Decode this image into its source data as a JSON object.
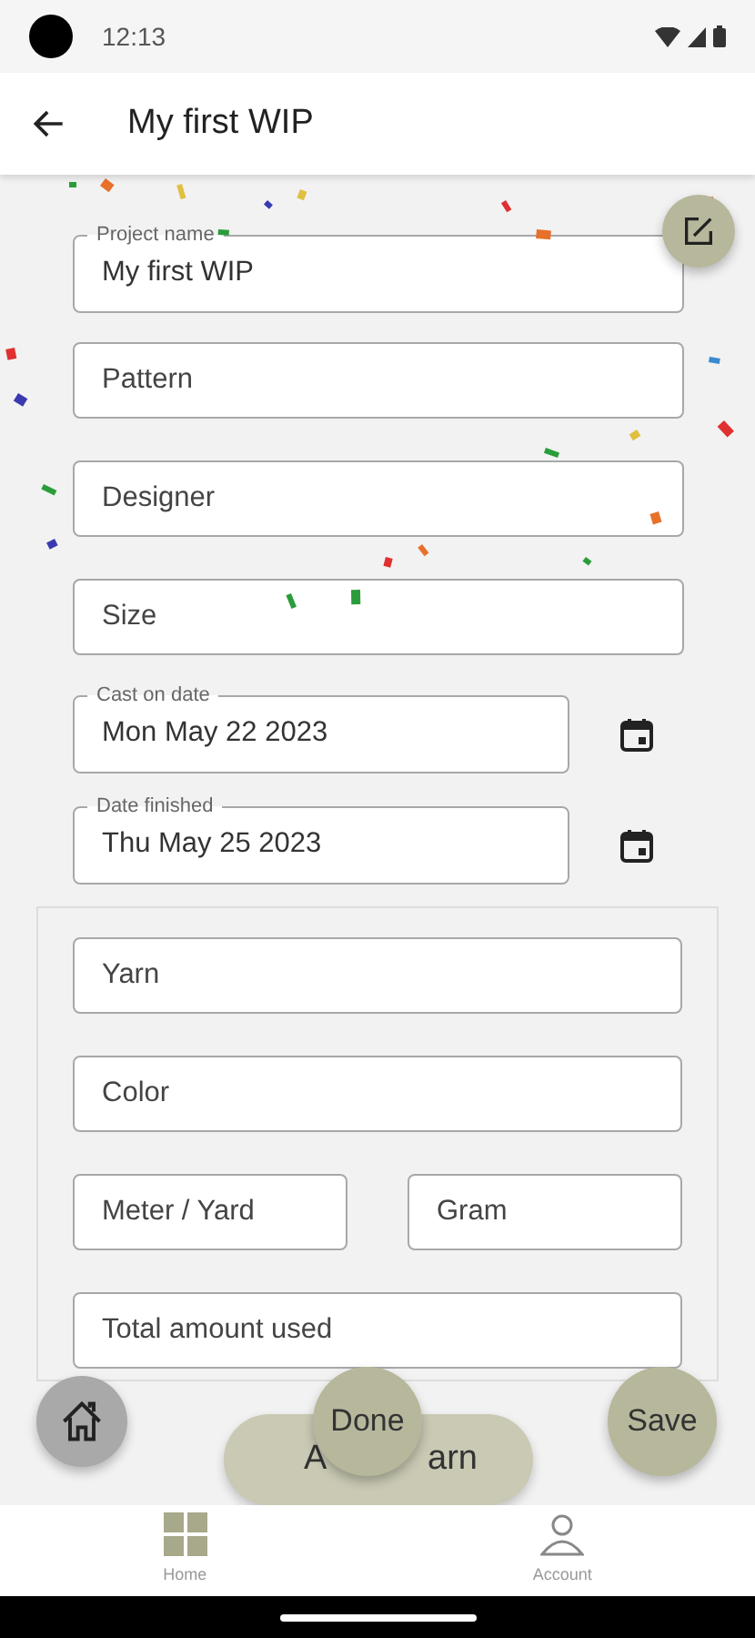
{
  "status_bar": {
    "time": "12:13"
  },
  "app_bar": {
    "title": "My first WIP"
  },
  "fields": [
    {
      "kind": "text",
      "label": "Project name",
      "value": "My first WIP"
    },
    {
      "kind": "text",
      "placeholder": "Pattern"
    },
    {
      "kind": "text",
      "placeholder": "Designer"
    },
    {
      "kind": "text",
      "placeholder": "Size"
    },
    {
      "kind": "date",
      "label": "Cast on date",
      "value": "Mon May 22 2023"
    },
    {
      "kind": "date",
      "label": "Date finished",
      "value": "Thu May 25 2023"
    }
  ],
  "yarn": {
    "fields": [
      {
        "kind": "full",
        "placeholder": "Yarn"
      },
      {
        "kind": "full",
        "placeholder": "Color"
      },
      {
        "kind": "half",
        "placeholder": "Meter / Yard"
      },
      {
        "kind": "half",
        "placeholder": "Gram"
      },
      {
        "kind": "full",
        "placeholder": "Total amount used"
      }
    ],
    "add_button_visible": [
      "A",
      "arn"
    ]
  },
  "actions": {
    "done": "Done",
    "save": "Save"
  },
  "bottom_nav": [
    {
      "label": "Home",
      "selected": true
    },
    {
      "label": "Account",
      "selected": false
    }
  ]
}
